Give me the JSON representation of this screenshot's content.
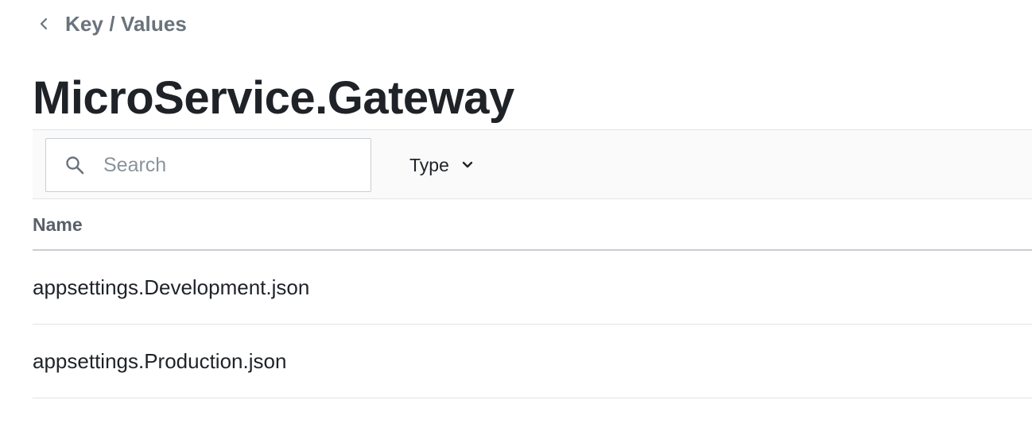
{
  "breadcrumb": {
    "label": "Key / Values",
    "back_icon": "chevron-left-icon"
  },
  "page": {
    "title": "MicroService.Gateway"
  },
  "toolbar": {
    "search": {
      "placeholder": "Search",
      "value": "",
      "icon": "search-icon"
    },
    "type_filter": {
      "label": "Type",
      "icon": "chevron-down-icon"
    }
  },
  "table": {
    "columns": [
      {
        "label": "Name"
      }
    ],
    "rows": [
      {
        "name": "appsettings.Development.json"
      },
      {
        "name": "appsettings.Production.json"
      }
    ]
  },
  "colors": {
    "text_primary": "#1f2328",
    "text_muted": "#6a737d",
    "border": "#e1e4e8",
    "toolbar_bg": "#fafafa"
  }
}
